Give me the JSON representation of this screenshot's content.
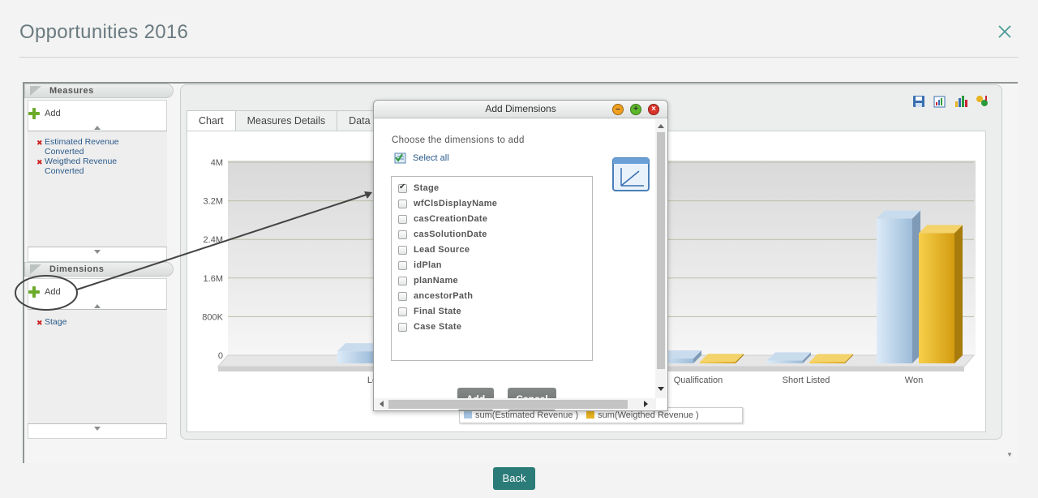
{
  "modal": {
    "title": "Opportunities 2016"
  },
  "left_panel": {
    "measures": {
      "header": "Measures",
      "add_label": "Add",
      "items": [
        {
          "label": "Estimated Revenue Converted"
        },
        {
          "label": "Weigthed Revenue Converted"
        }
      ]
    },
    "dimensions": {
      "header": "Dimensions",
      "add_label": "Add",
      "items": [
        {
          "label": "Stage"
        }
      ]
    }
  },
  "tabs": [
    {
      "label": "Chart",
      "active": true
    },
    {
      "label": "Measures Details",
      "active": false
    },
    {
      "label": "Data",
      "active": false
    }
  ],
  "toolbar_icons": [
    "save-icon",
    "export-chart-icon",
    "chart-type-icon",
    "settings-chart-icon"
  ],
  "chart_data": {
    "type": "bar",
    "categories": [
      "Lead",
      "",
      "",
      "Qualification",
      "Short Listed",
      "Won"
    ],
    "visible_category_labels": [
      "Le",
      "Qualification",
      "Short Listed",
      "Won"
    ],
    "series": [
      {
        "name": "sum(Estimated Revenue )",
        "color": "#a9c8e6",
        "values": [
          250000,
          null,
          null,
          100000,
          60000,
          3000000
        ]
      },
      {
        "name": "sum(Weigthed Revenue )",
        "color": "#e8b320",
        "values": [
          0,
          null,
          null,
          30000,
          25000,
          2700000
        ]
      }
    ],
    "y_ticks": [
      "4M",
      "3.2M",
      "2.4M",
      "1.6M",
      "800K",
      "0"
    ],
    "ylim": [
      0,
      4000000
    ],
    "grid": true,
    "legend_position": "bottom"
  },
  "dialog": {
    "title": "Add Dimensions",
    "choose_text": "Choose the dimensions to add",
    "select_all_label": "Select all",
    "options": [
      {
        "label": "Stage",
        "checked": true
      },
      {
        "label": "wfClsDisplayName",
        "checked": false
      },
      {
        "label": "casCreationDate",
        "checked": false
      },
      {
        "label": "casSolutionDate",
        "checked": false
      },
      {
        "label": "Lead Source",
        "checked": false
      },
      {
        "label": "idPlan",
        "checked": false
      },
      {
        "label": "planName",
        "checked": false
      },
      {
        "label": "ancestorPath",
        "checked": false
      },
      {
        "label": "Final State",
        "checked": false
      },
      {
        "label": "Case State",
        "checked": false
      }
    ],
    "add_button": "Add",
    "cancel_button": "Cancel"
  },
  "footer": {
    "back_button": "Back"
  },
  "colors": {
    "accent": "#2b7b78",
    "bar_blue": "#a9c8e6",
    "bar_gold": "#e8b320"
  }
}
